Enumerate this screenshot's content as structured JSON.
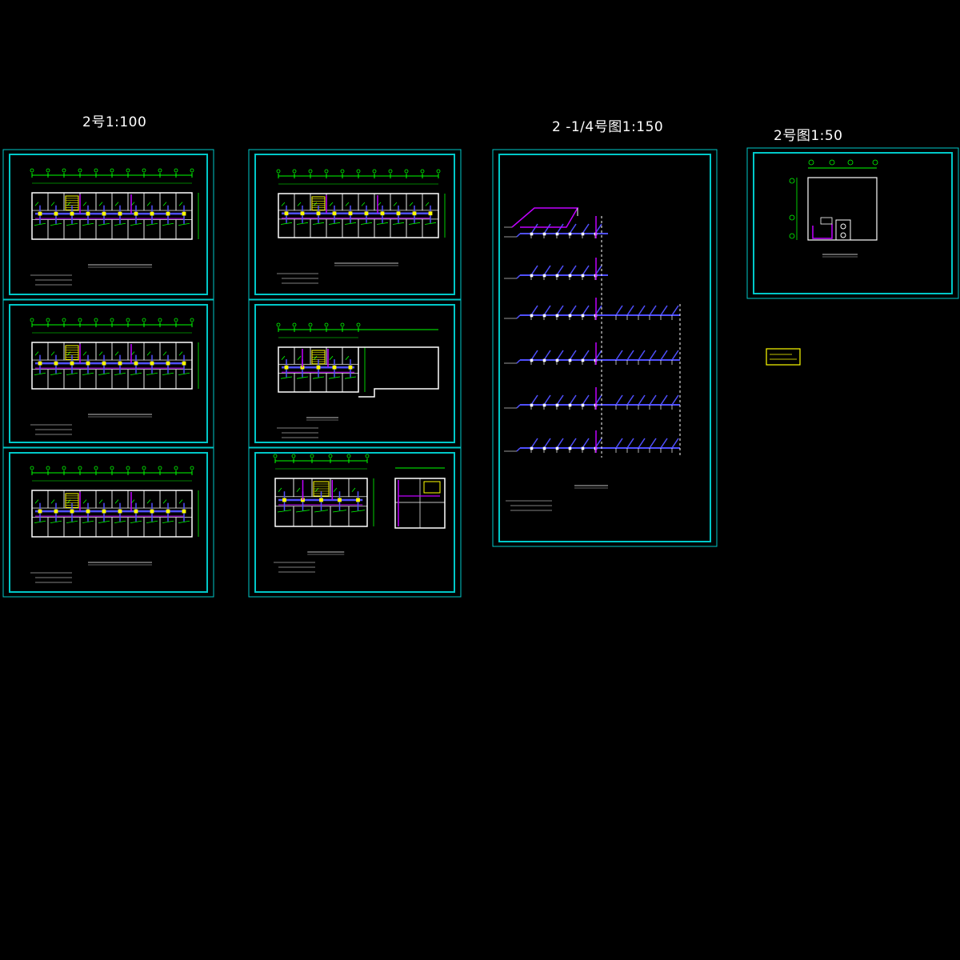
{
  "drawing": {
    "background": "#000000",
    "colors": {
      "frame": "#00c8c8",
      "wall": "#ffffff",
      "highlight": "#ffff00",
      "pipe": "#5050ff",
      "pipe_alt": "#c000ff",
      "dim": "#00ff00",
      "note_box": "#ffff00"
    },
    "groups": [
      {
        "label": "2号1:100"
      },
      {
        "label": "2 -1/4号图1:150"
      },
      {
        "label": "2号图1:50"
      }
    ]
  }
}
